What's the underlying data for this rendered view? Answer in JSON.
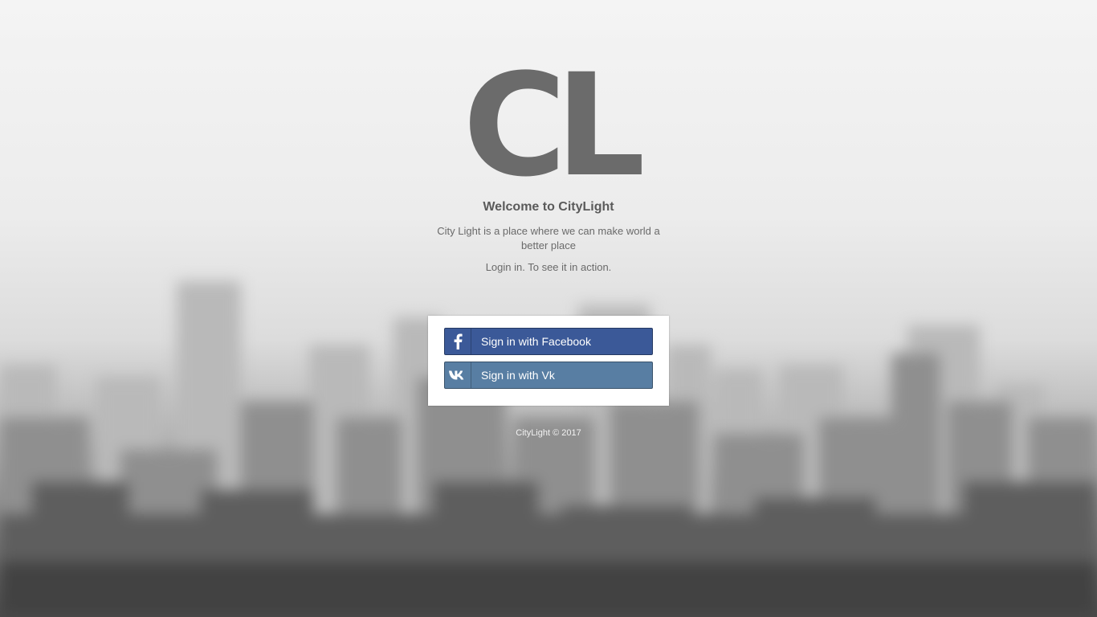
{
  "logo": {
    "text": "CL"
  },
  "welcome": {
    "title": "Welcome to CityLight"
  },
  "intro": {
    "description": "City Light is a place where we can make world a better place",
    "login_prompt": "Login in. To see it in action."
  },
  "login": {
    "facebook": {
      "label": "Sign in with Facebook",
      "icon": "facebook-icon",
      "color": "#3b5998"
    },
    "vk": {
      "label": "Sign in with Vk",
      "icon": "vk-icon",
      "color": "#587ea3"
    }
  },
  "footer": {
    "text": "CityLight © 2017"
  }
}
